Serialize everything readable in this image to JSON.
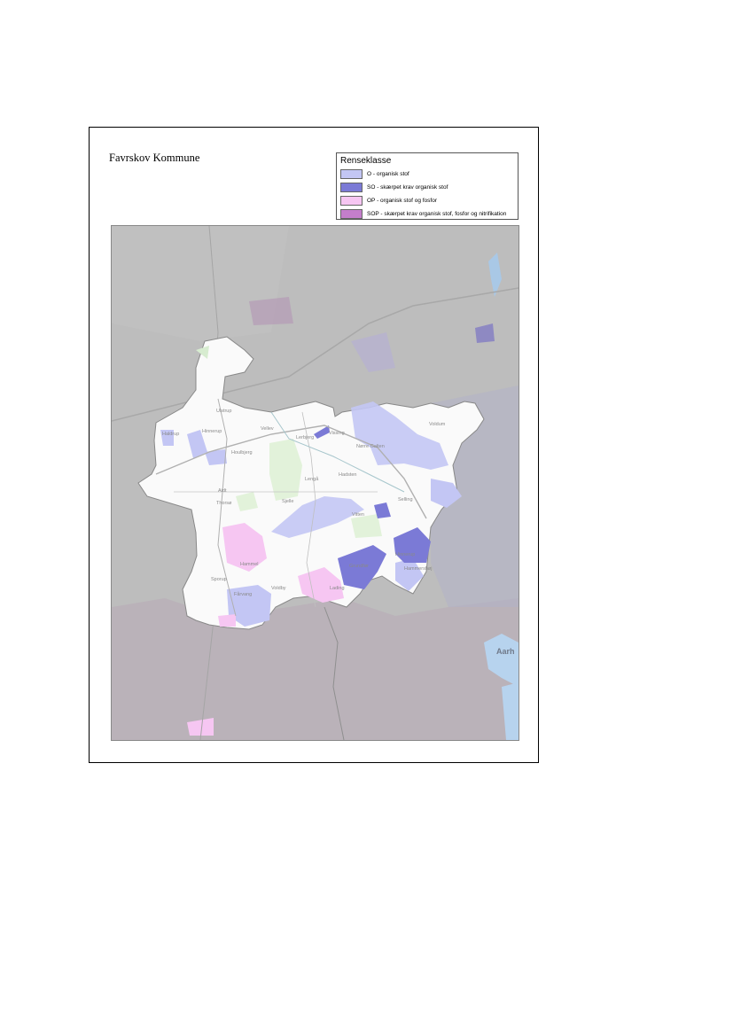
{
  "title": "Favrskov Kommune",
  "legend": {
    "title": "Renseklasse",
    "items": [
      {
        "label": "O - organisk stof",
        "color": "#c3c6f4"
      },
      {
        "label": "SO - skærpet krav organisk stof",
        "color": "#7b7ad6"
      },
      {
        "label": "OP - organisk stof og fosfor",
        "color": "#f6c6f2"
      },
      {
        "label": "SOP - skærpet krav organisk stof, fosfor og nitrifikation",
        "color": "#c47ecb"
      }
    ]
  },
  "map": {
    "places": [
      "Ulstrup",
      "Vellev",
      "Hinnerup",
      "Haldrup",
      "Houlbjerg",
      "Lerbjerg",
      "Vissing",
      "Nørre Galten",
      "Voldum",
      "Hadsten",
      "Lengå",
      "Sjelle",
      "Aidt",
      "Thorsø",
      "Hammel",
      "Vitten",
      "Selling",
      "Hinnerup",
      "Grundfør",
      "Lading",
      "Sporup",
      "Voldby",
      "Fårvang",
      "Hammershøj",
      "Aarh"
    ]
  },
  "colors": {
    "outside": "#bdbdbd",
    "municipality": "#fafafa",
    "outline": "#888888"
  }
}
